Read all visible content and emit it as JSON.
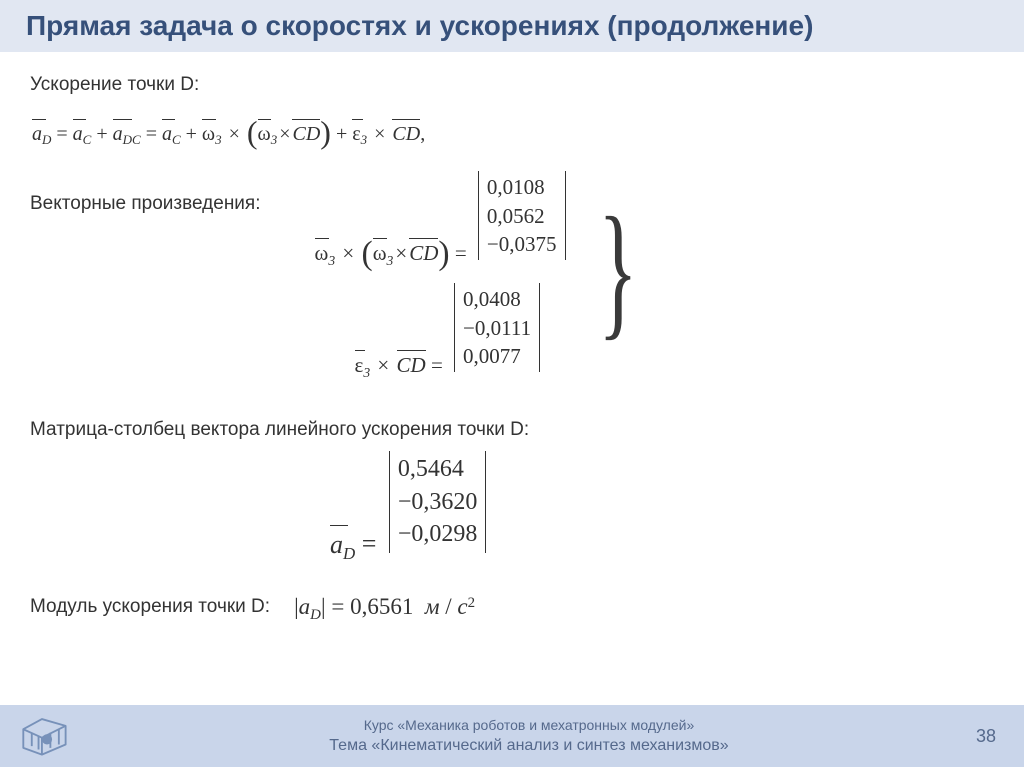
{
  "title": "Прямая задача о скоростях и ускорениях (продолжение)",
  "section1": {
    "label": "Ускорение точки D:",
    "eq": {
      "aD": "a",
      "aD_sub": "D",
      "aC": "a",
      "aC_sub": "C",
      "aDC": "a",
      "aDC_sub": "DC",
      "omega3": "ω",
      "omega3_sub": "3",
      "eps3": "ε",
      "eps3_sub": "3",
      "CD": "CD",
      "comma": ","
    }
  },
  "section2": {
    "label": "Векторные произведения:",
    "m1": {
      "r1": "0,0108",
      "r2": "0,0562",
      "r3": "−0,0375"
    },
    "m2": {
      "r1": "0,0408",
      "r2": "−0,0111",
      "r3": "0,0077"
    }
  },
  "section3": {
    "label": "Матрица-столбец вектора линейного ускорения точки D:",
    "m": {
      "r1": "0,5464",
      "r2": "−0,3620",
      "r3": "−0,0298"
    }
  },
  "section4": {
    "label": "Модуль ускорения точки D:",
    "val": "0,6561",
    "unit_m": "м",
    "unit_c": "с",
    "unit_sq": "2"
  },
  "footer": {
    "course": "Курс «Механика роботов и мехатронных модулей»",
    "theme": "Тема «Кинематический анализ и синтез механизмов»",
    "page": "38"
  }
}
